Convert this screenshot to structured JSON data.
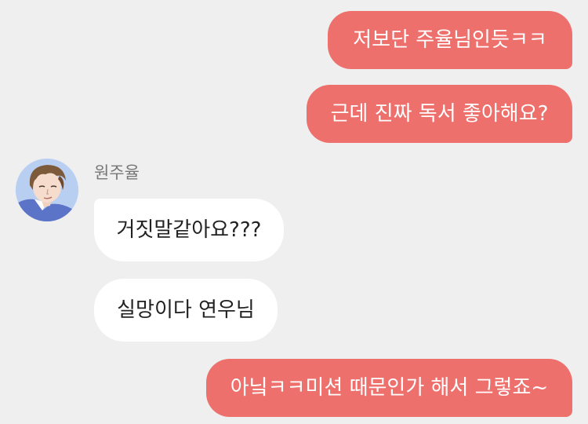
{
  "conversation": {
    "messages": [
      {
        "direction": "sent",
        "text": "저보단 주율님인듯ㅋㅋ"
      },
      {
        "direction": "sent",
        "text": "근데 진짜 독서 좋아해요?"
      },
      {
        "direction": "received",
        "sender": "원주율",
        "text": "거짓말같아요???"
      },
      {
        "direction": "received",
        "sender": "원주율",
        "text": "실망이다 연우님"
      },
      {
        "direction": "sent",
        "text": "아닠ㅋㅋ미션 때문인가 해서 그렇죠~"
      }
    ],
    "contact": {
      "name": "원주율",
      "avatar_icon": "user-avatar-illustration"
    }
  },
  "colors": {
    "background": "#efefef",
    "sent_bubble": "#ee706c",
    "sent_text": "#ffffff",
    "received_bubble": "#ffffff",
    "received_text": "#222222",
    "sender_name": "#777777"
  }
}
